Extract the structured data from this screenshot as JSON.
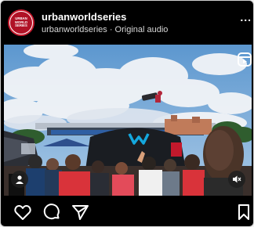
{
  "post": {
    "author": {
      "username": "urbanworldseries",
      "logo_lines": [
        "URBAN",
        "WORLD",
        "SERIES"
      ]
    },
    "audio_line": "urbanworldseries · Original audio",
    "more_label": "...",
    "media": {
      "type": "reel",
      "banner_brand": "Movistar M-logo",
      "colors": {
        "sky": "#6ea6d8",
        "banner": "#1e3f6e",
        "inflatable": "#1a1d22",
        "brand_cyan": "#14a8de"
      }
    },
    "icons": {
      "reel": "reels-icon",
      "user_tag": "user-tag-icon",
      "mute": "speaker-muted-icon",
      "like": "heart-icon",
      "comment": "comment-icon",
      "share": "send-icon",
      "save": "bookmark-icon"
    }
  }
}
